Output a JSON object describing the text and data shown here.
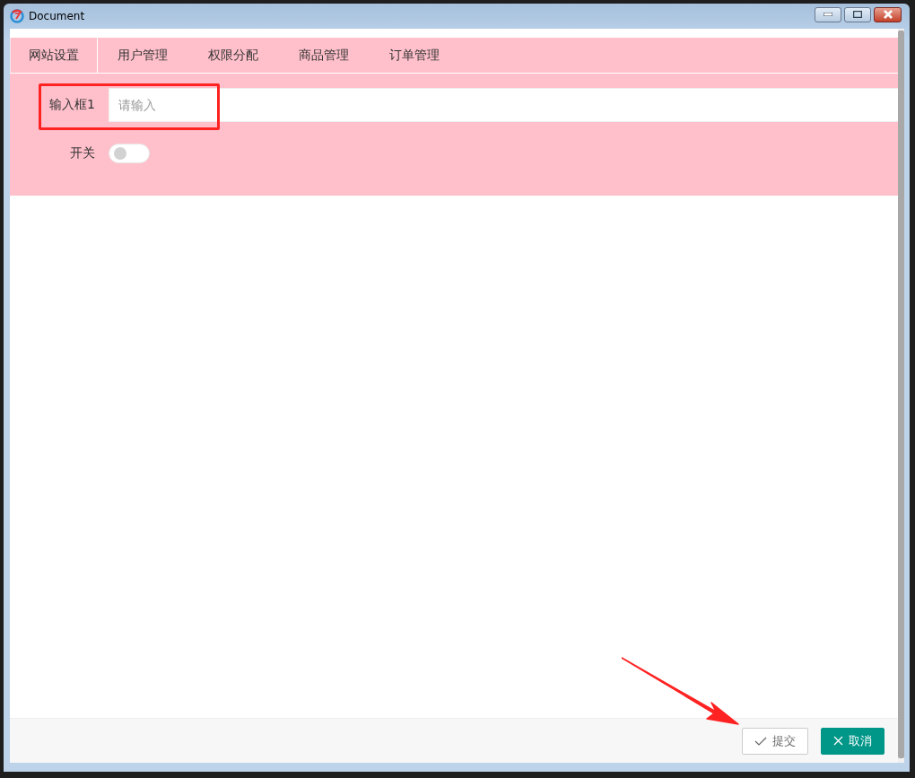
{
  "window": {
    "title": "Document"
  },
  "tabs": [
    {
      "label": "网站设置",
      "selected": true
    },
    {
      "label": "用户管理",
      "selected": false
    },
    {
      "label": "权限分配",
      "selected": false
    },
    {
      "label": "商品管理",
      "selected": false
    },
    {
      "label": "订单管理",
      "selected": false
    }
  ],
  "form": {
    "input": {
      "label": "输入框1",
      "placeholder": "请输入"
    },
    "switch": {
      "label": "开关",
      "on": false
    }
  },
  "buttons": [
    {
      "kind": "submit",
      "label": "提交"
    },
    {
      "kind": "cancel",
      "label": "取消"
    }
  ]
}
